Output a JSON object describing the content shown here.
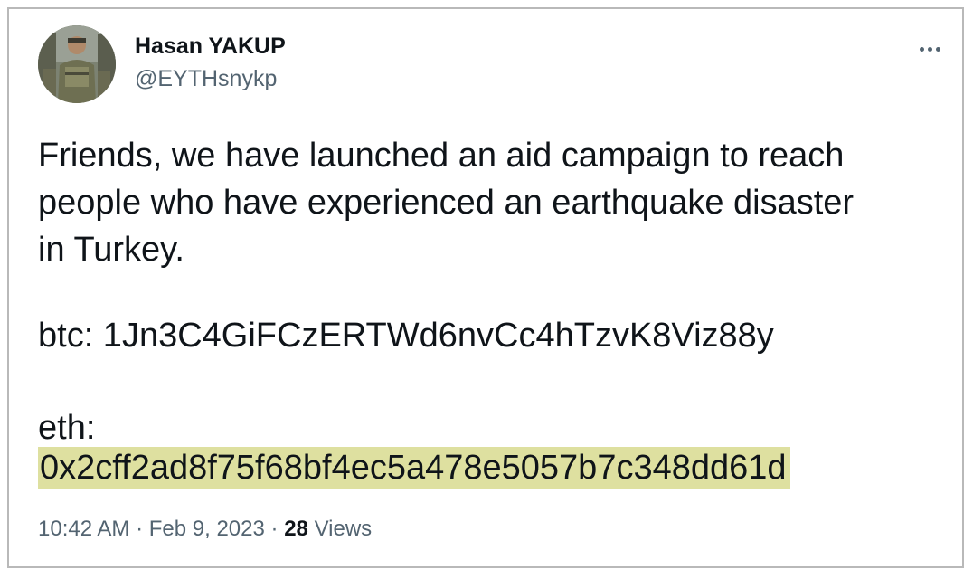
{
  "author": {
    "name": "Hasan YAKUP",
    "handle": "@EYTHsnykp",
    "avatar_icon": "user-avatar-photo"
  },
  "menu": {
    "more_icon": "more-horizontal-icon"
  },
  "tweet": {
    "lines": [
      "Friends, we have launched an aid campaign to reach",
      "people who have experienced an earthquake disaster",
      "in Turkey."
    ],
    "btc_line": "btc: 1Jn3C4GiFCzERTWd6nvCc4hTzvK8Viz88y",
    "eth_label": "eth:",
    "eth_address": "0x2cff2ad8f75f68bf4ec5a478e5057b7c348dd61d",
    "highlight_color": "#dee0a0"
  },
  "meta": {
    "time": "10:42 AM",
    "separator": "·",
    "date": "Feb 9, 2023",
    "views_count": "28",
    "views_label": "Views"
  }
}
